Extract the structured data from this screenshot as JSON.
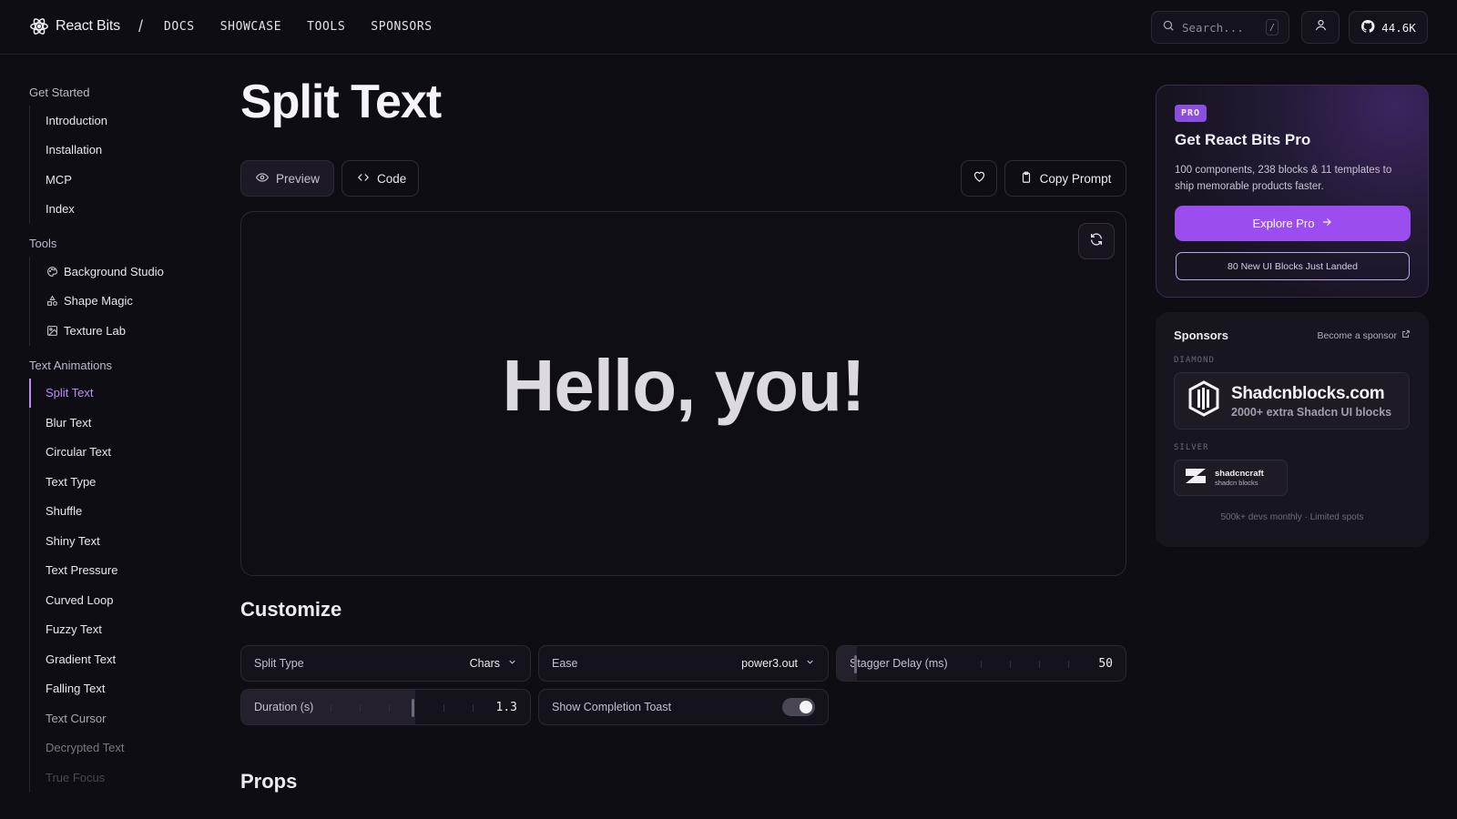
{
  "header": {
    "brand": "React Bits",
    "separator": "/",
    "nav": [
      "DOCS",
      "SHOWCASE",
      "TOOLS",
      "SPONSORS"
    ],
    "search_placeholder": "Search...",
    "search_shortcut": "/",
    "github_stars": "44.6K"
  },
  "sidebar": {
    "sections": [
      {
        "title": "Get Started",
        "items": [
          "Introduction",
          "Installation",
          "MCP",
          "Index"
        ]
      },
      {
        "title": "Tools",
        "items": [
          "Background Studio",
          "Shape Magic",
          "Texture Lab"
        ]
      },
      {
        "title": "Text Animations",
        "items": [
          "Split Text",
          "Blur Text",
          "Circular Text",
          "Text Type",
          "Shuffle",
          "Shiny Text",
          "Text Pressure",
          "Curved Loop",
          "Fuzzy Text",
          "Gradient Text",
          "Falling Text",
          "Text Cursor",
          "Decrypted Text",
          "True Focus"
        ]
      }
    ],
    "active_item": "Split Text"
  },
  "main": {
    "title": "Split Text",
    "tabs": {
      "preview": "Preview",
      "code": "Code"
    },
    "copy_prompt": "Copy Prompt",
    "preview_text": "Hello, you!",
    "customize_title": "Customize",
    "props_title": "Props",
    "controls": {
      "split_type": {
        "label": "Split Type",
        "value": "Chars"
      },
      "ease": {
        "label": "Ease",
        "value": "power3.out"
      },
      "stagger": {
        "label": "Stagger Delay (ms)",
        "value": "50"
      },
      "duration": {
        "label": "Duration (s)",
        "value": "1.3"
      },
      "toast": {
        "label": "Show Completion Toast",
        "enabled": true
      }
    }
  },
  "promo": {
    "badge": "PRO",
    "title": "Get React Bits Pro",
    "description": "100 components, 238 blocks & 11 templates to ship memorable products faster.",
    "cta": "Explore Pro",
    "news": "80 New UI Blocks Just Landed"
  },
  "sponsors": {
    "title": "Sponsors",
    "become": "Become a sponsor",
    "diamond_label": "DIAMOND",
    "diamond": {
      "name": "Shadcnblocks.com",
      "tagline": "2000+ extra Shadcn UI blocks"
    },
    "silver_label": "SILVER",
    "silver": {
      "name": "shadcncraft",
      "tagline": "shadcn blocks"
    },
    "footer": "500k+ devs monthly · Limited spots"
  },
  "colors": {
    "accent": "#b98df5",
    "pro_button": "#9c4df0",
    "background": "#0f0d14"
  }
}
